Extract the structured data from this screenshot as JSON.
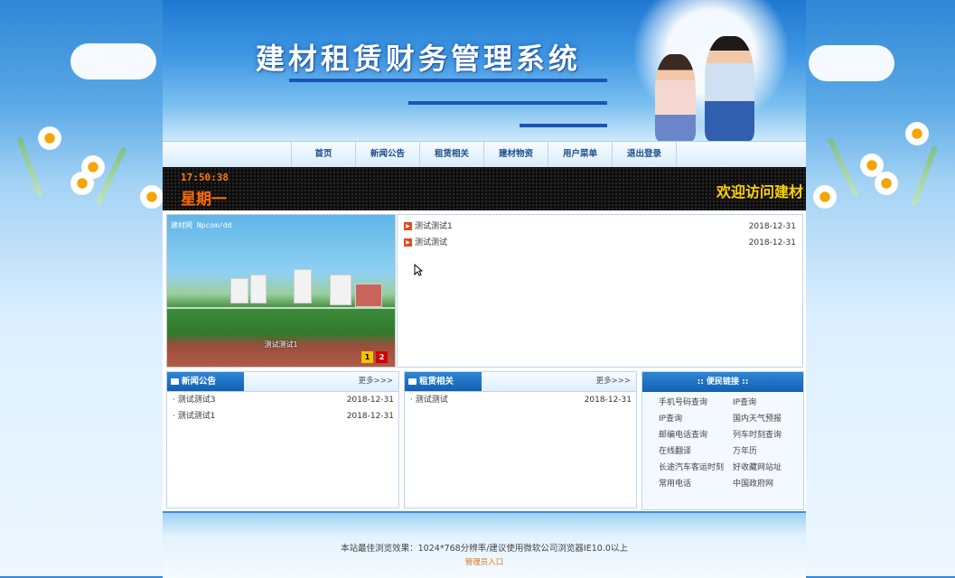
{
  "header": {
    "title": "建材租赁财务管理系统"
  },
  "nav": {
    "items": [
      "首页",
      "新闻公告",
      "租赁相关",
      "建材物资",
      "用户菜单",
      "退出登录"
    ]
  },
  "led": {
    "time": "17:50:38",
    "weekday": "星期一",
    "marquee": "欢迎访问建材"
  },
  "slideshow": {
    "logo": "建材网 Npcom/dd",
    "caption": "测试测试1",
    "pages": [
      "1",
      "2"
    ]
  },
  "notices": [
    {
      "title": "测试测试1",
      "date": "2018-12-31"
    },
    {
      "title": "测试测试",
      "date": "2018-12-31"
    }
  ],
  "news": {
    "title": "新闻公告",
    "more": "更多>>>",
    "items": [
      {
        "title": "测试测试3",
        "date": "2018-12-31"
      },
      {
        "title": "测试测试1",
        "date": "2018-12-31"
      }
    ]
  },
  "rental": {
    "title": "租赁相关",
    "more": "更多>>>",
    "items": [
      {
        "title": "测试测试",
        "date": "2018-12-31"
      }
    ]
  },
  "links": {
    "title": ":: 便民链接 ::",
    "items": [
      "手机号码查询",
      "IP查询",
      "IP查询",
      "国内天气预报",
      "邮编电话查询",
      "列车时刻查询",
      "在线翻译",
      "万年历",
      "长途汽车客运时刻",
      "好收藏网站址",
      "常用电话",
      "中国政府网"
    ]
  },
  "footer": {
    "text": "本站最佳浏览效果：1024*768分辨率/建议使用微软公司浏览器IE10.0以上",
    "admin": "管理员入口"
  }
}
